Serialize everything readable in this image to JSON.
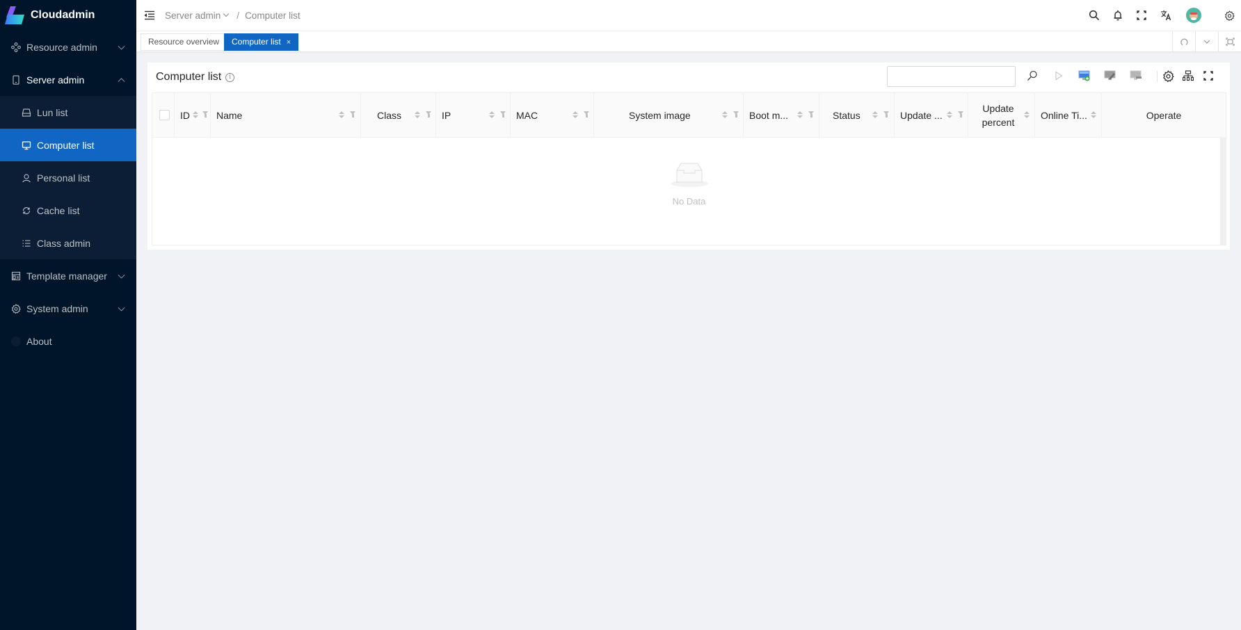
{
  "app": {
    "name": "Cloudadmin"
  },
  "sidebar": {
    "items": [
      {
        "label": "Resource admin",
        "icon": "resource-icon",
        "expanded": false
      },
      {
        "label": "Server admin",
        "icon": "server-icon",
        "expanded": true,
        "children": [
          {
            "label": "Lun list",
            "icon": "disk-icon"
          },
          {
            "label": "Computer list",
            "icon": "monitor-icon",
            "active": true
          },
          {
            "label": "Personal list",
            "icon": "user-icon"
          },
          {
            "label": "Cache list",
            "icon": "sync-icon"
          },
          {
            "label": "Class admin",
            "icon": "list-icon"
          }
        ]
      },
      {
        "label": "Template manager",
        "icon": "template-icon",
        "expanded": false
      },
      {
        "label": "System admin",
        "icon": "gear-icon",
        "expanded": false
      },
      {
        "label": "About",
        "icon": "about-icon"
      }
    ]
  },
  "header": {
    "breadcrumb": [
      {
        "label": "Server admin",
        "dropdown": true
      },
      {
        "label": "Computer list"
      }
    ],
    "separator": "/",
    "icons": [
      "search-icon",
      "bell-icon",
      "fullscreen-icon",
      "translate-icon",
      "avatar",
      "gear-icon"
    ]
  },
  "tabs": [
    {
      "label": "Resource overview",
      "active": false
    },
    {
      "label": "Computer list",
      "active": true,
      "close": "×"
    }
  ],
  "card": {
    "title": "Computer list",
    "info": "i",
    "search": {
      "value": "",
      "placeholder": ""
    }
  },
  "table": {
    "columns": [
      {
        "label": "ID",
        "sortable": true,
        "filter": true
      },
      {
        "label": "Name",
        "sortable": true,
        "filter": true
      },
      {
        "label": "Class",
        "sortable": true,
        "filter": true
      },
      {
        "label": "IP",
        "sortable": true,
        "filter": true
      },
      {
        "label": "MAC",
        "sortable": true,
        "filter": true
      },
      {
        "label": "System image",
        "sortable": true,
        "filter": true
      },
      {
        "label": "Boot m...",
        "sortable": true,
        "filter": true
      },
      {
        "label": "Status",
        "sortable": true,
        "filter": true
      },
      {
        "label": "Update ...",
        "sortable": true,
        "filter": true
      },
      {
        "label": "Update percent",
        "sortable": true,
        "filter": false
      },
      {
        "label": "Online Ti...",
        "sortable": true,
        "filter": false
      },
      {
        "label": "Operate",
        "sortable": false,
        "filter": false
      }
    ],
    "rows": [],
    "empty_text": "No Data"
  },
  "colors": {
    "sidebar": "#001529",
    "submenu": "#0c1e35",
    "accent": "#1166c4",
    "background": "#f0f2f5"
  }
}
